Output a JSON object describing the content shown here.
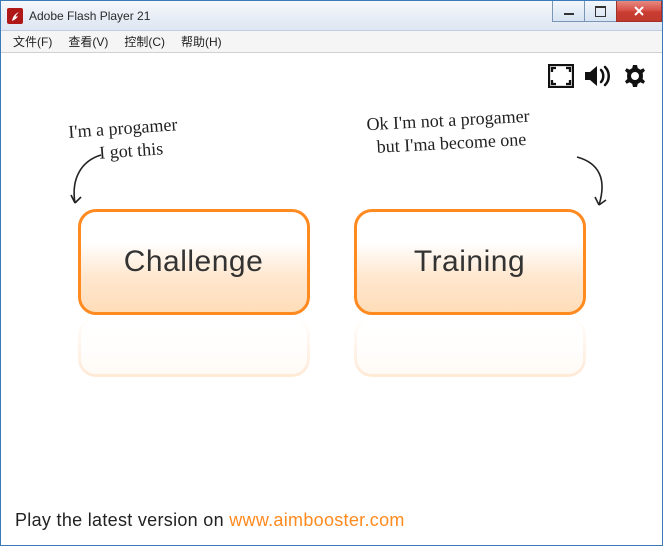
{
  "window": {
    "title": "Adobe Flash Player 21"
  },
  "menu": {
    "file": "文件(F)",
    "view": "查看(V)",
    "control": "控制(C)",
    "help": "帮助(H)"
  },
  "notes": {
    "left": "I'm a progamer\n   I got this",
    "right": "Ok I'm not a progamer\n but I'ma become one"
  },
  "buttons": {
    "challenge": "Challenge",
    "training": "Training"
  },
  "footer": {
    "prefix": "Play the latest version on ",
    "url": "www.aimbooster.com"
  }
}
